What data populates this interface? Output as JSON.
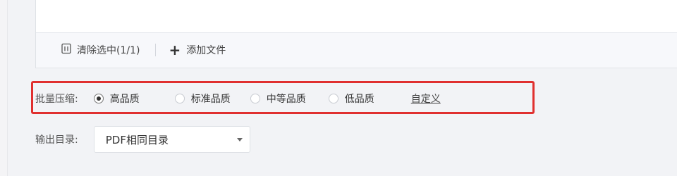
{
  "toolbar": {
    "clear_selected_label": "清除选中(1/1)",
    "add_file_label": "添加文件",
    "clear_icon": "trash-icon",
    "add_icon": "plus-icon"
  },
  "compress": {
    "label": "批量压缩:",
    "options": [
      "高品质",
      "标准品质",
      "中等品质",
      "低品质"
    ],
    "selected": "高品质",
    "custom_link": "自定义"
  },
  "output": {
    "label": "输出目录:",
    "selected_value": "PDF相同目录"
  },
  "colors": {
    "highlight_border": "#e0302f",
    "page_background": "#f2f3f6"
  }
}
